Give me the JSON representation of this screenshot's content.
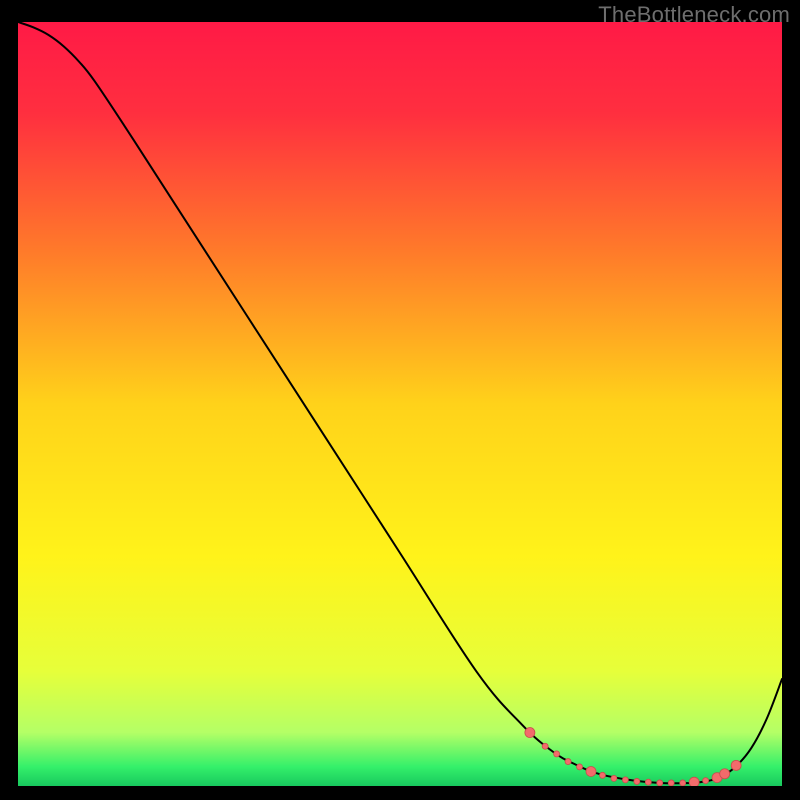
{
  "watermark": "TheBottleneck.com",
  "chart_data": {
    "type": "line",
    "title": "",
    "xlabel": "",
    "ylabel": "",
    "xlim": [
      0,
      100
    ],
    "ylim": [
      0,
      100
    ],
    "background_gradient": {
      "stops": [
        {
          "offset": 0.0,
          "color": "#ff1a46"
        },
        {
          "offset": 0.12,
          "color": "#ff2f3f"
        },
        {
          "offset": 0.3,
          "color": "#ff7a2a"
        },
        {
          "offset": 0.5,
          "color": "#ffd21a"
        },
        {
          "offset": 0.7,
          "color": "#fff31a"
        },
        {
          "offset": 0.85,
          "color": "#e6ff3a"
        },
        {
          "offset": 0.93,
          "color": "#b4ff66"
        },
        {
          "offset": 0.975,
          "color": "#34f06a"
        },
        {
          "offset": 1.0,
          "color": "#18c85e"
        }
      ]
    },
    "series": [
      {
        "name": "curve",
        "stroke": "#000000",
        "stroke_width": 2,
        "x": [
          0,
          2,
          4,
          6,
          8,
          10,
          14,
          20,
          30,
          40,
          50,
          60,
          66,
          70,
          73,
          76,
          80,
          84,
          88,
          90,
          92,
          94,
          96,
          98,
          100
        ],
        "y": [
          100,
          99.3,
          98.3,
          96.8,
          94.8,
          92.3,
          86.3,
          77.0,
          61.5,
          46.0,
          30.5,
          15.0,
          8.0,
          4.5,
          2.8,
          1.6,
          0.8,
          0.4,
          0.4,
          0.6,
          1.2,
          2.6,
          5.0,
          8.8,
          14.0
        ]
      }
    ],
    "markers": {
      "name": "highlight-dots",
      "fill": "#f36b6b",
      "stroke": "#c94d4d",
      "r_small": 3.0,
      "r_large": 5.0,
      "points": [
        {
          "x": 67.0,
          "y": 7.0,
          "size": "large"
        },
        {
          "x": 69.0,
          "y": 5.2,
          "size": "small"
        },
        {
          "x": 70.5,
          "y": 4.2,
          "size": "small"
        },
        {
          "x": 72.0,
          "y": 3.2,
          "size": "small"
        },
        {
          "x": 73.5,
          "y": 2.5,
          "size": "small"
        },
        {
          "x": 75.0,
          "y": 1.9,
          "size": "large"
        },
        {
          "x": 76.5,
          "y": 1.4,
          "size": "small"
        },
        {
          "x": 78.0,
          "y": 1.0,
          "size": "small"
        },
        {
          "x": 79.5,
          "y": 0.8,
          "size": "small"
        },
        {
          "x": 81.0,
          "y": 0.6,
          "size": "small"
        },
        {
          "x": 82.5,
          "y": 0.5,
          "size": "small"
        },
        {
          "x": 84.0,
          "y": 0.4,
          "size": "small"
        },
        {
          "x": 85.5,
          "y": 0.4,
          "size": "small"
        },
        {
          "x": 87.0,
          "y": 0.4,
          "size": "small"
        },
        {
          "x": 88.5,
          "y": 0.5,
          "size": "large"
        },
        {
          "x": 90.0,
          "y": 0.7,
          "size": "small"
        },
        {
          "x": 91.5,
          "y": 1.1,
          "size": "large"
        },
        {
          "x": 92.5,
          "y": 1.6,
          "size": "large"
        },
        {
          "x": 94.0,
          "y": 2.7,
          "size": "large"
        }
      ]
    }
  }
}
